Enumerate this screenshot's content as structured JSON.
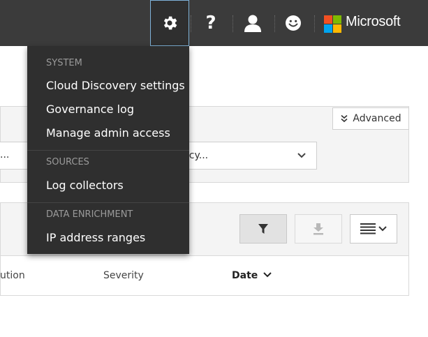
{
  "topbar": {
    "brand": "Microsoft",
    "icons": [
      "gear-icon",
      "help-icon",
      "user-icon",
      "smiley-icon"
    ],
    "active_bg": "#2f2f2f",
    "bar_bg": "#3b3b3b"
  },
  "settings_menu": {
    "sections": [
      {
        "title": "SYSTEM",
        "items": [
          "Cloud Discovery settings",
          "Governance log",
          "Manage admin access"
        ]
      },
      {
        "title": "SOURCES",
        "items": [
          "Log collectors"
        ]
      },
      {
        "title": "DATA ENRICHMENT",
        "items": [
          "IP address ranges"
        ]
      }
    ]
  },
  "filters": {
    "advanced_label": "Advanced",
    "left_select_value": "...",
    "policy_select_value": "licy..."
  },
  "table": {
    "columns": [
      "ution",
      "Severity",
      "Date"
    ]
  }
}
